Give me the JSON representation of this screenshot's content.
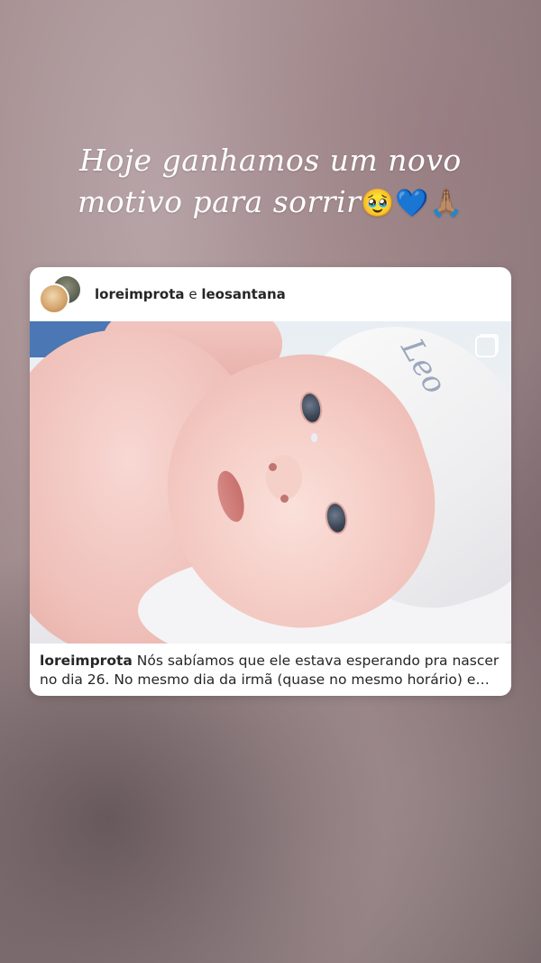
{
  "story": {
    "caption_line1": "Hoje ganhamos um novo",
    "caption_line2": "motivo para sorrir",
    "caption_emojis": [
      "🥹",
      "💙",
      "🙏🏽"
    ]
  },
  "post": {
    "author": "loreimprota",
    "connector": "e",
    "collaborator": "leosantana",
    "caption_author": "loreimprota",
    "caption_text": "Nós sabíamos que ele estava esperando pra nascer no dia 26. No mesmo dia da irmã (quase no mesmo horário) e no...",
    "hat_text": "Leo"
  },
  "icons": {
    "multi": "carousel-icon"
  }
}
